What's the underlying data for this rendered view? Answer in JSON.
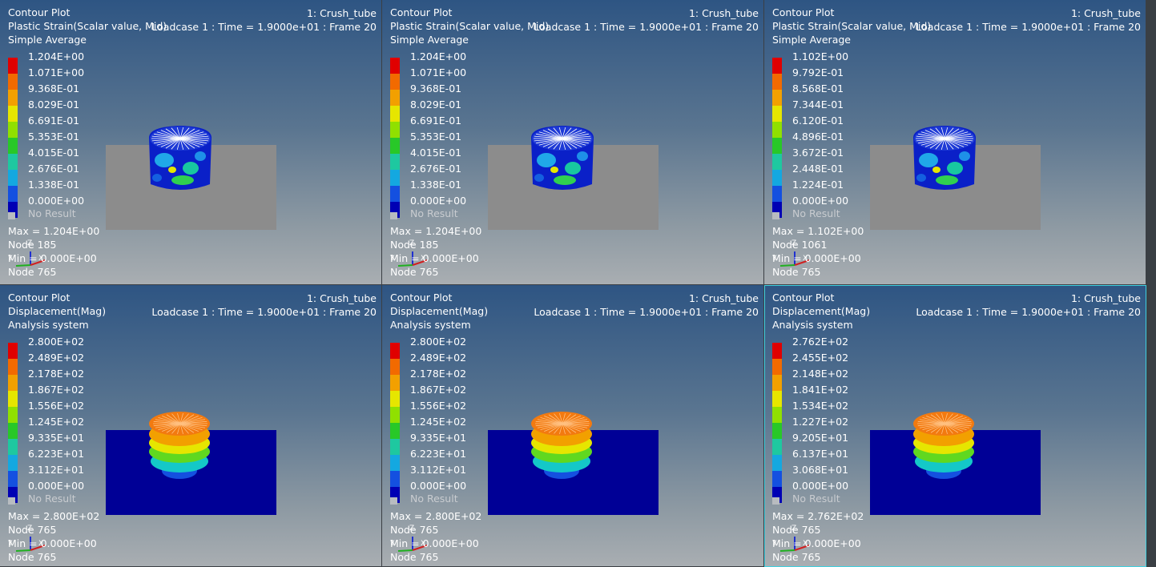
{
  "viewports": [
    {
      "title": "Contour Plot",
      "result": "Plastic Strain(Scalar value, Mid)",
      "averaging": "Simple Average",
      "model": "1: Crush_tube",
      "loadcase": "Loadcase 1 : Time = 1.9000e+01 : Frame 20",
      "legend": [
        "1.204E+00",
        "1.071E+00",
        "9.368E-01",
        "8.029E-01",
        "6.691E-01",
        "5.353E-01",
        "4.015E-01",
        "2.676E-01",
        "1.338E-01",
        "0.000E+00"
      ],
      "no_result": "No Result",
      "max_label": "Max = 1.204E+00",
      "max_node": "Node 185",
      "min_label": "Min = 0.000E+00",
      "min_node": "Node 765",
      "triad_labels": {
        "y": "Y",
        "z": "Z",
        "x": "X"
      },
      "plot_kind": "strain",
      "active": false
    },
    {
      "title": "Contour Plot",
      "result": "Plastic Strain(Scalar value, Mid)",
      "averaging": "Simple Average",
      "model": "1: Crush_tube",
      "loadcase": "Loadcase 1 : Time = 1.9000e+01 : Frame 20",
      "legend": [
        "1.204E+00",
        "1.071E+00",
        "9.368E-01",
        "8.029E-01",
        "6.691E-01",
        "5.353E-01",
        "4.015E-01",
        "2.676E-01",
        "1.338E-01",
        "0.000E+00"
      ],
      "no_result": "No Result",
      "max_label": "Max = 1.204E+00",
      "max_node": "Node 185",
      "min_label": "Min = 0.000E+00",
      "min_node": "Node 765",
      "triad_labels": {
        "y": "Y",
        "z": "Z",
        "x": "X"
      },
      "plot_kind": "strain",
      "active": false
    },
    {
      "title": "Contour Plot",
      "result": "Plastic Strain(Scalar value, Mid)",
      "averaging": "Simple Average",
      "model": "1: Crush_tube",
      "loadcase": "Loadcase 1 : Time = 1.9000e+01 : Frame 20",
      "legend": [
        "1.102E+00",
        "9.792E-01",
        "8.568E-01",
        "7.344E-01",
        "6.120E-01",
        "4.896E-01",
        "3.672E-01",
        "2.448E-01",
        "1.224E-01",
        "0.000E+00"
      ],
      "no_result": "No Result",
      "max_label": "Max = 1.102E+00",
      "max_node": "Node 1061",
      "min_label": "Min = 0.000E+00",
      "min_node": "Node 765",
      "triad_labels": {
        "y": "Y",
        "z": "Z",
        "x": "X"
      },
      "plot_kind": "strain",
      "active": false
    },
    {
      "title": "Contour Plot",
      "result": "Displacement(Mag)",
      "averaging": "Analysis system",
      "model": "1: Crush_tube",
      "loadcase": "Loadcase 1 : Time = 1.9000e+01 : Frame 20",
      "legend": [
        "2.800E+02",
        "2.489E+02",
        "2.178E+02",
        "1.867E+02",
        "1.556E+02",
        "1.245E+02",
        "9.335E+01",
        "6.223E+01",
        "3.112E+01",
        "0.000E+00"
      ],
      "no_result": "No Result",
      "max_label": "Max = 2.800E+02",
      "max_node": "Node 765",
      "min_label": "Min = 0.000E+00",
      "min_node": "Node 765",
      "triad_labels": {
        "y": "Y",
        "z": "Z",
        "x": "X"
      },
      "plot_kind": "displacement",
      "active": false
    },
    {
      "title": "Contour Plot",
      "result": "Displacement(Mag)",
      "averaging": "Analysis system",
      "model": "1: Crush_tube",
      "loadcase": "Loadcase 1 : Time = 1.9000e+01 : Frame 20",
      "legend": [
        "2.800E+02",
        "2.489E+02",
        "2.178E+02",
        "1.867E+02",
        "1.556E+02",
        "1.245E+02",
        "9.335E+01",
        "6.223E+01",
        "3.112E+01",
        "0.000E+00"
      ],
      "no_result": "No Result",
      "max_label": "Max = 2.800E+02",
      "max_node": "Node 765",
      "min_label": "Min = 0.000E+00",
      "min_node": "Node 765",
      "triad_labels": {
        "y": "Y",
        "z": "Z",
        "x": "X"
      },
      "plot_kind": "displacement",
      "active": false
    },
    {
      "title": "Contour Plot",
      "result": "Displacement(Mag)",
      "averaging": "Analysis system",
      "model": "1: Crush_tube",
      "loadcase": "Loadcase 1 : Time = 1.9000e+01 : Frame 20",
      "legend": [
        "2.762E+02",
        "2.455E+02",
        "2.148E+02",
        "1.841E+02",
        "1.534E+02",
        "1.227E+02",
        "9.205E+01",
        "6.137E+01",
        "3.068E+01",
        "0.000E+00"
      ],
      "no_result": "No Result",
      "max_label": "Max = 2.762E+02",
      "max_node": "Node 765",
      "min_label": "Min = 0.000E+00",
      "min_node": "Node 765",
      "triad_labels": {
        "y": "Y",
        "z": "Z",
        "x": "X"
      },
      "plot_kind": "displacement",
      "active": true
    }
  ],
  "colors": {
    "legend_bands": [
      "#e00000",
      "#f26a00",
      "#f2a000",
      "#e6e600",
      "#90e000",
      "#28c828",
      "#1ec8a0",
      "#14a8e0",
      "#1450e0",
      "#0000b4"
    ],
    "no_result": "#b8bcc0",
    "plate_strain": "#8c8c8c",
    "plate_displacement": "#000096",
    "active_border": "#3fd0e0"
  }
}
